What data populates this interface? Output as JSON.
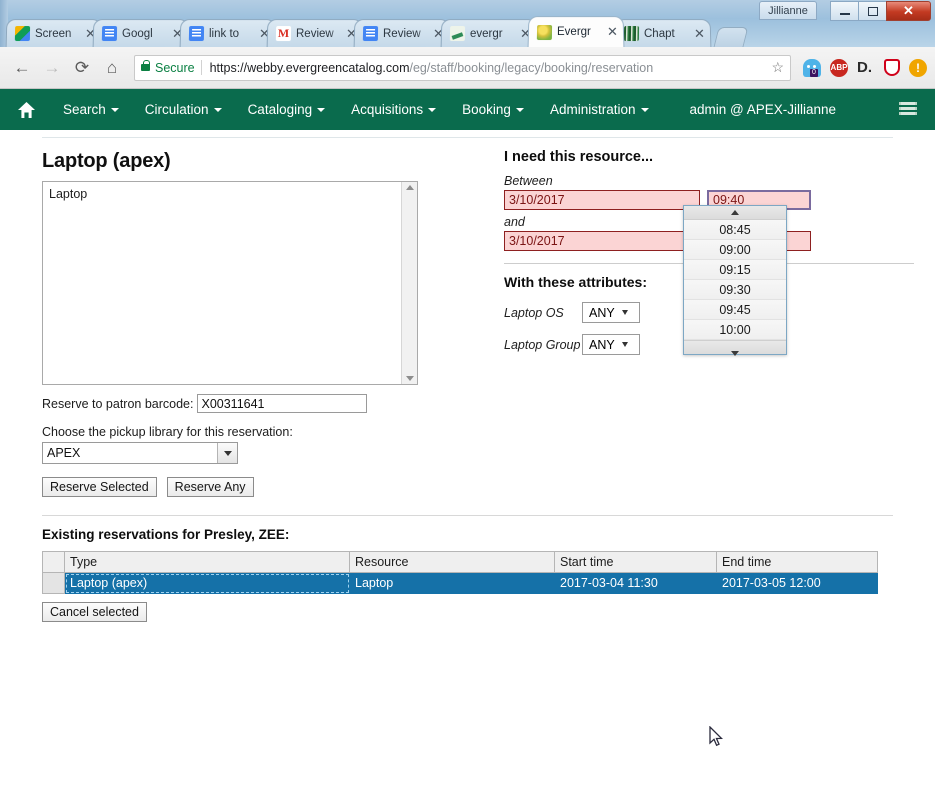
{
  "window": {
    "profile_name": "Jillianne",
    "minimize_label": "Minimize",
    "maximize_label": "Maximize",
    "close_label": "✕"
  },
  "browser": {
    "tabs": [
      {
        "title": "Screen",
        "favicon": "google-drive-icon"
      },
      {
        "title": "Googl",
        "favicon": "google-docs-icon"
      },
      {
        "title": "link to",
        "favicon": "google-docs-icon"
      },
      {
        "title": "Review",
        "favicon": "gmail-icon"
      },
      {
        "title": "Review",
        "favicon": "google-docs-icon"
      },
      {
        "title": "evergr",
        "favicon": "evergreen-pen-icon"
      },
      {
        "title": "Evergr",
        "favicon": "evergreen-icon",
        "active": true
      },
      {
        "title": "Chapt",
        "favicon": "chapters-icon"
      }
    ],
    "tab_close_glyph": "✕",
    "back_glyph": "←",
    "forward_glyph": "→",
    "reload_glyph": "⟳",
    "home_glyph": "⌂",
    "security_label": "Secure",
    "url_host": "https://webby.evergreencatalog.com",
    "url_path": "/eg/staff/booking/legacy/booking/reservation",
    "bookmark_glyph": "☆",
    "extensions": [
      {
        "name": "ghostery-icon",
        "badge": "0"
      },
      {
        "name": "adblock-plus-icon",
        "label": "ABP"
      },
      {
        "name": "disconnect-icon",
        "label": "D."
      },
      {
        "name": "privacy-shield-icon",
        "label": ""
      },
      {
        "name": "alert-icon",
        "label": "!"
      }
    ]
  },
  "evergreen_nav": {
    "home_glyph": "⌂",
    "items": [
      {
        "label": "Search",
        "has_caret": true
      },
      {
        "label": "Circulation",
        "has_caret": true
      },
      {
        "label": "Cataloging",
        "has_caret": true
      },
      {
        "label": "Acquisitions",
        "has_caret": true
      },
      {
        "label": "Booking",
        "has_caret": true
      },
      {
        "label": "Administration",
        "has_caret": true
      }
    ],
    "user": "admin @ APEX-Jillianne"
  },
  "reservation": {
    "title": "Laptop (apex)",
    "resource_list": [
      "Laptop"
    ],
    "patron_barcode_label": "Reserve to patron barcode:",
    "patron_barcode_value": "X00311641",
    "pickup_library_label": "Choose the pickup library for this reservation:",
    "pickup_library_value": "APEX",
    "reserve_selected_label": "Reserve Selected",
    "reserve_any_label": "Reserve Any"
  },
  "need_panel": {
    "title": "I need this resource...",
    "between_label": "Between",
    "start_date": "3/10/2017",
    "start_time": "09:40",
    "and_label": "and",
    "end_date": "3/10/2017",
    "end_time": "",
    "attributes_title": "With these attributes:",
    "attributes": [
      {
        "label": "Laptop OS",
        "value": "ANY"
      },
      {
        "label": "Laptop Group",
        "value": "ANY"
      }
    ]
  },
  "time_dropdown": {
    "scroll_up_glyph": "▲",
    "scroll_down_glyph": "▼",
    "options": [
      "08:45",
      "09:00",
      "09:15",
      "09:30",
      "09:45",
      "10:00"
    ]
  },
  "existing": {
    "title": "Existing reservations for Presley, ZEE:",
    "columns": [
      "Type",
      "Resource",
      "Start time",
      "End time"
    ],
    "rows": [
      {
        "selected": true,
        "cells": [
          "Laptop (apex)",
          "Laptop",
          "2017-03-04 11:30",
          "2017-03-05 12:00"
        ]
      }
    ],
    "cancel_label": "Cancel selected"
  },
  "colors": {
    "evergreen_green": "#0a6b4d",
    "selected_row_blue": "#1571a8",
    "invalid_field_bg": "#fbd4d4",
    "invalid_field_border": "#8e2020",
    "secure_green": "#0b8043"
  }
}
